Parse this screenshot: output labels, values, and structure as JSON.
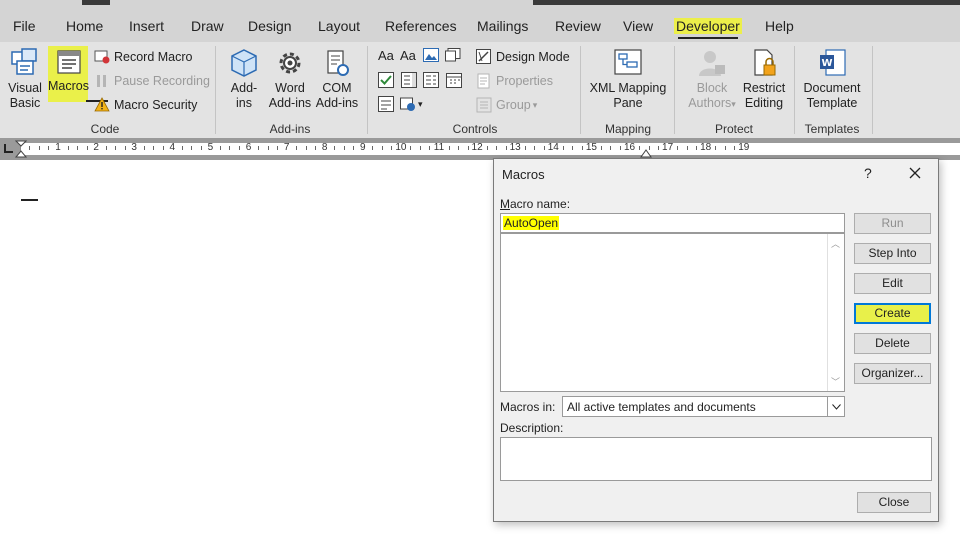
{
  "tabs": [
    {
      "label": "File"
    },
    {
      "label": "Home"
    },
    {
      "label": "Insert"
    },
    {
      "label": "Draw"
    },
    {
      "label": "Design"
    },
    {
      "label": "Layout"
    },
    {
      "label": "References"
    },
    {
      "label": "Mailings"
    },
    {
      "label": "Review"
    },
    {
      "label": "View"
    },
    {
      "label": "Developer"
    },
    {
      "label": "Help"
    }
  ],
  "ribbon": {
    "code": {
      "group_label": "Code",
      "visual_basic": "Visual\nBasic",
      "macros": "Macros",
      "record_macro": "Record Macro",
      "pause_recording": "Pause Recording",
      "macro_security": "Macro Security"
    },
    "addins": {
      "group_label": "Add-ins",
      "addins": "Add-\nins",
      "word_addins": "Word\nAdd-ins",
      "com_addins": "COM\nAdd-ins"
    },
    "controls": {
      "group_label": "Controls",
      "design_mode": "Design Mode",
      "properties": "Properties",
      "group": "Group",
      "aa_text": "Aa",
      "aa_text2": "Aa"
    },
    "mapping": {
      "group_label": "Mapping",
      "xml_mapping": "XML Mapping\nPane"
    },
    "protect": {
      "group_label": "Protect",
      "block_authors": "Block\nAuthors",
      "restrict_editing": "Restrict\nEditing"
    },
    "templates": {
      "group_label": "Templates",
      "document_template": "Document\nTemplate"
    }
  },
  "ruler": {
    "numbers": [
      "1",
      "2",
      "3",
      "4",
      "5",
      "6",
      "7",
      "8",
      "9",
      "10",
      "11",
      "12",
      "13",
      "14",
      "15",
      "16",
      "17",
      "18",
      "19"
    ]
  },
  "dialog": {
    "title": "Macros",
    "help": "?",
    "macro_name_label": "Macro name:",
    "macro_name_value": "AutoOpen",
    "macros_in_label": "Macros in:",
    "macros_in_value": "All active templates and documents",
    "description_label": "Description:",
    "buttons": {
      "run": "Run",
      "step_into": "Step Into",
      "edit": "Edit",
      "create": "Create",
      "delete": "Delete",
      "organizer": "Organizer...",
      "close": "Close"
    }
  },
  "colors": {
    "highlight": "#eaf04a",
    "focus_border": "#0078d7",
    "ribbon_bg": "#e3e3e3",
    "tabs_bg": "#d4d4d4"
  }
}
